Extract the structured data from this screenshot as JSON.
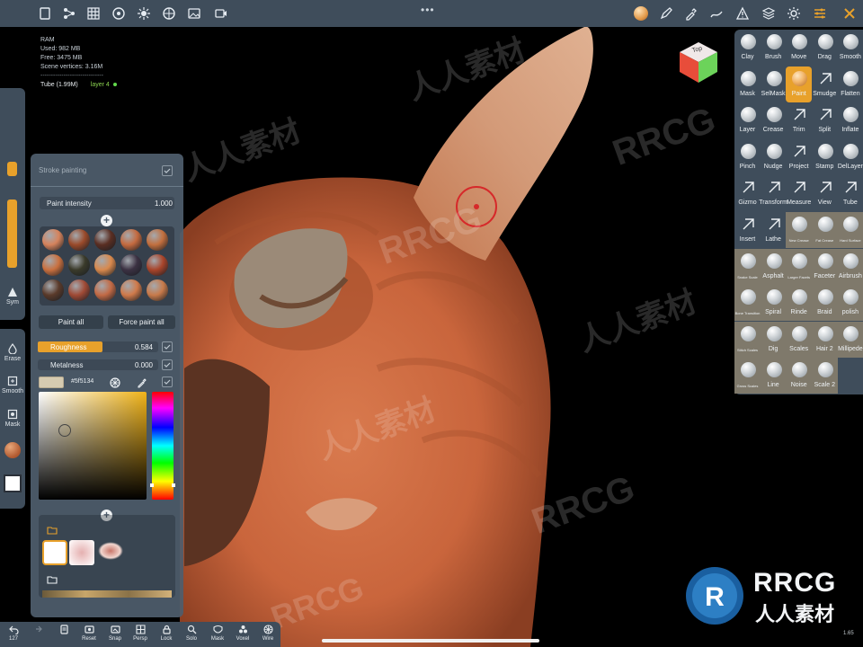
{
  "stats": {
    "ram": "RAM",
    "used": "Used: 982 MB",
    "free": "Free: 3475 MB",
    "vertices": "Scene vertices: 3.16M",
    "separator": "------------------------------",
    "object": "Tube (1.99M)",
    "layer": "layer 4"
  },
  "cube": {
    "top_label": "Top",
    "colors": {
      "top": "#f0e8e8",
      "left": "#e84d3a",
      "right": "#6cd35a"
    }
  },
  "left_toolbar": {
    "sym": "Sym",
    "erase": "Erase",
    "smooth": "Smooth",
    "mask": "Mask"
  },
  "paint_panel": {
    "title": "Stroke painting",
    "intensity_label": "Paint intensity",
    "intensity_value": "1.000",
    "paint_all": "Paint all",
    "force_paint_all": "Force paint all",
    "roughness_label": "Roughness",
    "roughness_value": "0.584",
    "metalness_label": "Metalness",
    "metalness_value": "0.000",
    "hex": "#5f5134",
    "swatch_color": "#d6cbb1",
    "materials": [
      "#d6835c",
      "#9a4a2a",
      "#5a2e22",
      "#c46a3f",
      "#c26f3e",
      "#c9703f",
      "#3a3a2a",
      "#d8894d",
      "#3b3142",
      "#a8442a",
      "#5a3a2a",
      "#a04a35",
      "#c26a45",
      "#d07a4a",
      "#c87a4a"
    ]
  },
  "tools": [
    {
      "label": "Clay"
    },
    {
      "label": "Brush"
    },
    {
      "label": "Move"
    },
    {
      "label": "Drag"
    },
    {
      "label": "Smooth"
    },
    {
      "label": "Mask"
    },
    {
      "label": "SelMask"
    },
    {
      "label": "Paint"
    },
    {
      "label": "Smudge"
    },
    {
      "label": "Flatten"
    },
    {
      "label": "Layer"
    },
    {
      "label": "Crease"
    },
    {
      "label": "Trim"
    },
    {
      "label": "Split"
    },
    {
      "label": "Inflate"
    },
    {
      "label": "Pinch"
    },
    {
      "label": "Nudge"
    },
    {
      "label": "Project"
    },
    {
      "label": "Stamp"
    },
    {
      "label": "DelLayer"
    },
    {
      "label": "Gizmo"
    },
    {
      "label": "Transform"
    },
    {
      "label": "Measure"
    },
    {
      "label": "View"
    },
    {
      "label": "Tube"
    },
    {
      "label": "Insert"
    },
    {
      "label": "Lathe"
    },
    {
      "label": "New Crease"
    },
    {
      "label": "Fat Crease"
    },
    {
      "label": "Hard Surface"
    },
    {
      "label": "Snake Scale"
    },
    {
      "label": "Asphalt"
    },
    {
      "label": "Larger Facets"
    },
    {
      "label": "Faceter"
    },
    {
      "label": "Airbrush"
    },
    {
      "label": "Bone Transition"
    },
    {
      "label": "Spiral"
    },
    {
      "label": "Rinde"
    },
    {
      "label": "Braid"
    },
    {
      "label": "polish"
    },
    {
      "label": "Stitch Scales"
    },
    {
      "label": "Dig"
    },
    {
      "label": "Scales"
    },
    {
      "label": "Hair 2"
    },
    {
      "label": "Millipede"
    },
    {
      "label": "Gross Scales"
    },
    {
      "label": "Line"
    },
    {
      "label": "Noise"
    },
    {
      "label": "Scale 2"
    }
  ],
  "bottom_bar": {
    "undo_count": "127",
    "reset": "Reset",
    "snap": "Snap",
    "persp": "Persp",
    "lock": "Lock",
    "solo": "Solo",
    "mask": "Mask",
    "voxel": "Voxel",
    "wire": "Wire"
  },
  "zoom": "1.65",
  "watermarks": {
    "brand": "RRCG",
    "cn": "人人素材"
  }
}
